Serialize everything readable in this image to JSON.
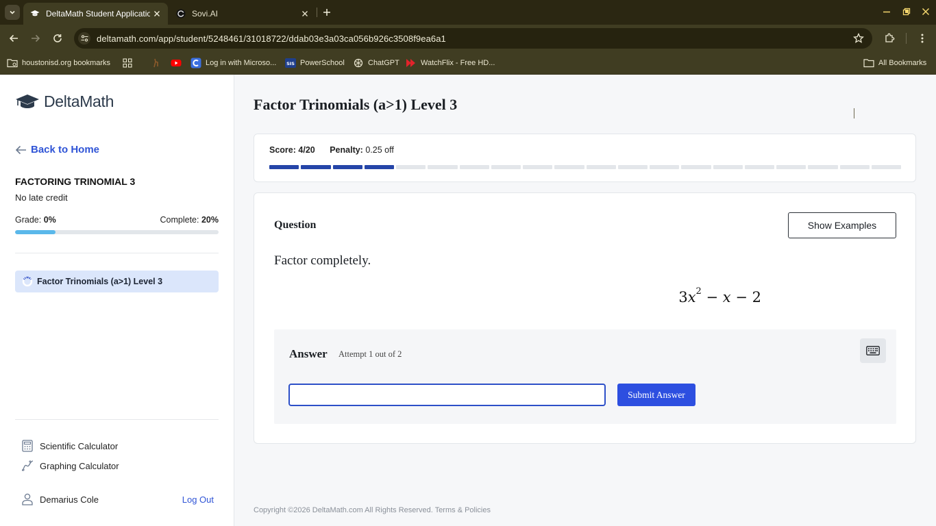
{
  "browser": {
    "tabs": [
      {
        "title": "DeltaMath Student Application",
        "active": true
      },
      {
        "title": "Sovi.AI",
        "active": false
      }
    ],
    "url": "deltamath.com/app/student/5248461/31018722/ddab03e3a03ca056b926c3508f9ea6a1",
    "bookmarks": [
      {
        "label": "houstonisd.org bookmarks",
        "icon": "folder-icon"
      },
      {
        "label": "",
        "icon": "apps-grid-icon"
      },
      {
        "label": "",
        "icon": "deer-icon"
      },
      {
        "label": "",
        "icon": "youtube-icon"
      },
      {
        "label": "Log in with Microso...",
        "icon": "c-logo-icon"
      },
      {
        "label": "PowerSchool",
        "icon": "sis-icon"
      },
      {
        "label": "ChatGPT",
        "icon": "chatgpt-icon"
      },
      {
        "label": "WatchFlix - Free HD...",
        "icon": "watchflix-icon"
      }
    ],
    "all_bookmarks": "All Bookmarks"
  },
  "sidebar": {
    "logo_text": "DeltaMath",
    "back_label": "Back to Home",
    "assignment_title": "FACTORING TRINOMIAL 3",
    "late_credit": "No late credit",
    "grade_label": "Grade:",
    "grade_value": "0%",
    "complete_label": "Complete:",
    "complete_value": "20%",
    "complete_fraction": 0.2,
    "problem_item": "Factor Trinomials (a>1) Level 3",
    "tools": [
      {
        "label": "Scientific Calculator",
        "icon": "calculator-icon"
      },
      {
        "label": "Graphing Calculator",
        "icon": "graph-icon"
      }
    ],
    "user_name": "Demarius Cole",
    "logout_label": "Log Out"
  },
  "main": {
    "title": "Factor Trinomials (a>1) Level 3",
    "score_label": "Score:",
    "score_value": "4/20",
    "score_done": 4,
    "score_total": 20,
    "penalty_label": "Penalty:",
    "penalty_value": "0.25 off",
    "question_label": "Question",
    "show_examples": "Show Examples",
    "prompt": "Factor completely.",
    "expression": {
      "coef": "3",
      "var": "x",
      "exp": "2",
      "rest_minus1": "−",
      "term2": "x",
      "rest_minus2": "−",
      "const": "2"
    },
    "answer_label": "Answer",
    "attempt_text": "Attempt 1 out of 2",
    "answer_value": "",
    "submit_label": "Submit Answer"
  },
  "footer": {
    "copyright": "Copyright ©2026 DeltaMath.com All Rights Reserved. Terms & Policies"
  }
}
